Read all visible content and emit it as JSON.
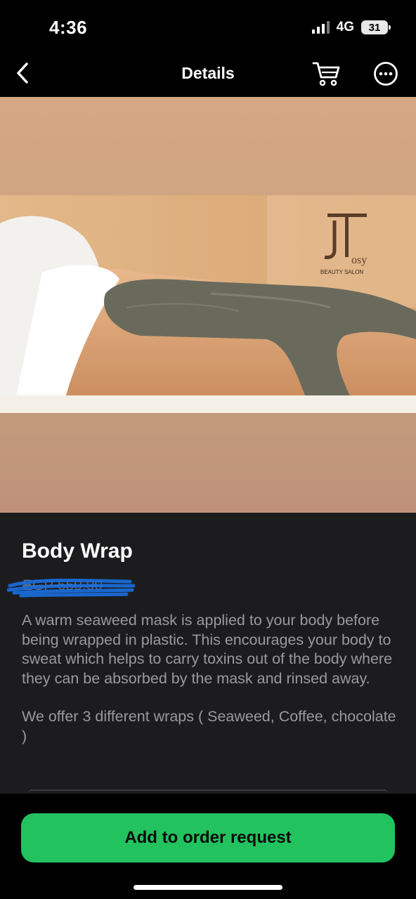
{
  "status_bar": {
    "time": "4:36",
    "network": "4G",
    "battery": "31"
  },
  "nav": {
    "title": "Details",
    "back_icon": "chevron-left-icon",
    "cart_icon": "cart-icon",
    "more_icon": "more-horizontal-icon"
  },
  "hero": {
    "logo_text": "osy",
    "logo_subtitle": "BEAUTY SALON"
  },
  "service": {
    "title": "Body Wrap",
    "price": "EGP 650.00",
    "description": [
      "A warm seaweed mask is applied to your body before being wrapped in plastic. This encourages your body to sweat which helps to carry toxins out of the body where they can be absorbed by the mask and rinsed away.",
      "We offer 3 different wraps ( Seaweed, Coffee, chocolate )"
    ]
  },
  "actions": {
    "order_label": "Add to order request"
  },
  "colors": {
    "accent": "#22c35e",
    "background": "#1c1c1e",
    "scribble": "#1a6fe0"
  }
}
